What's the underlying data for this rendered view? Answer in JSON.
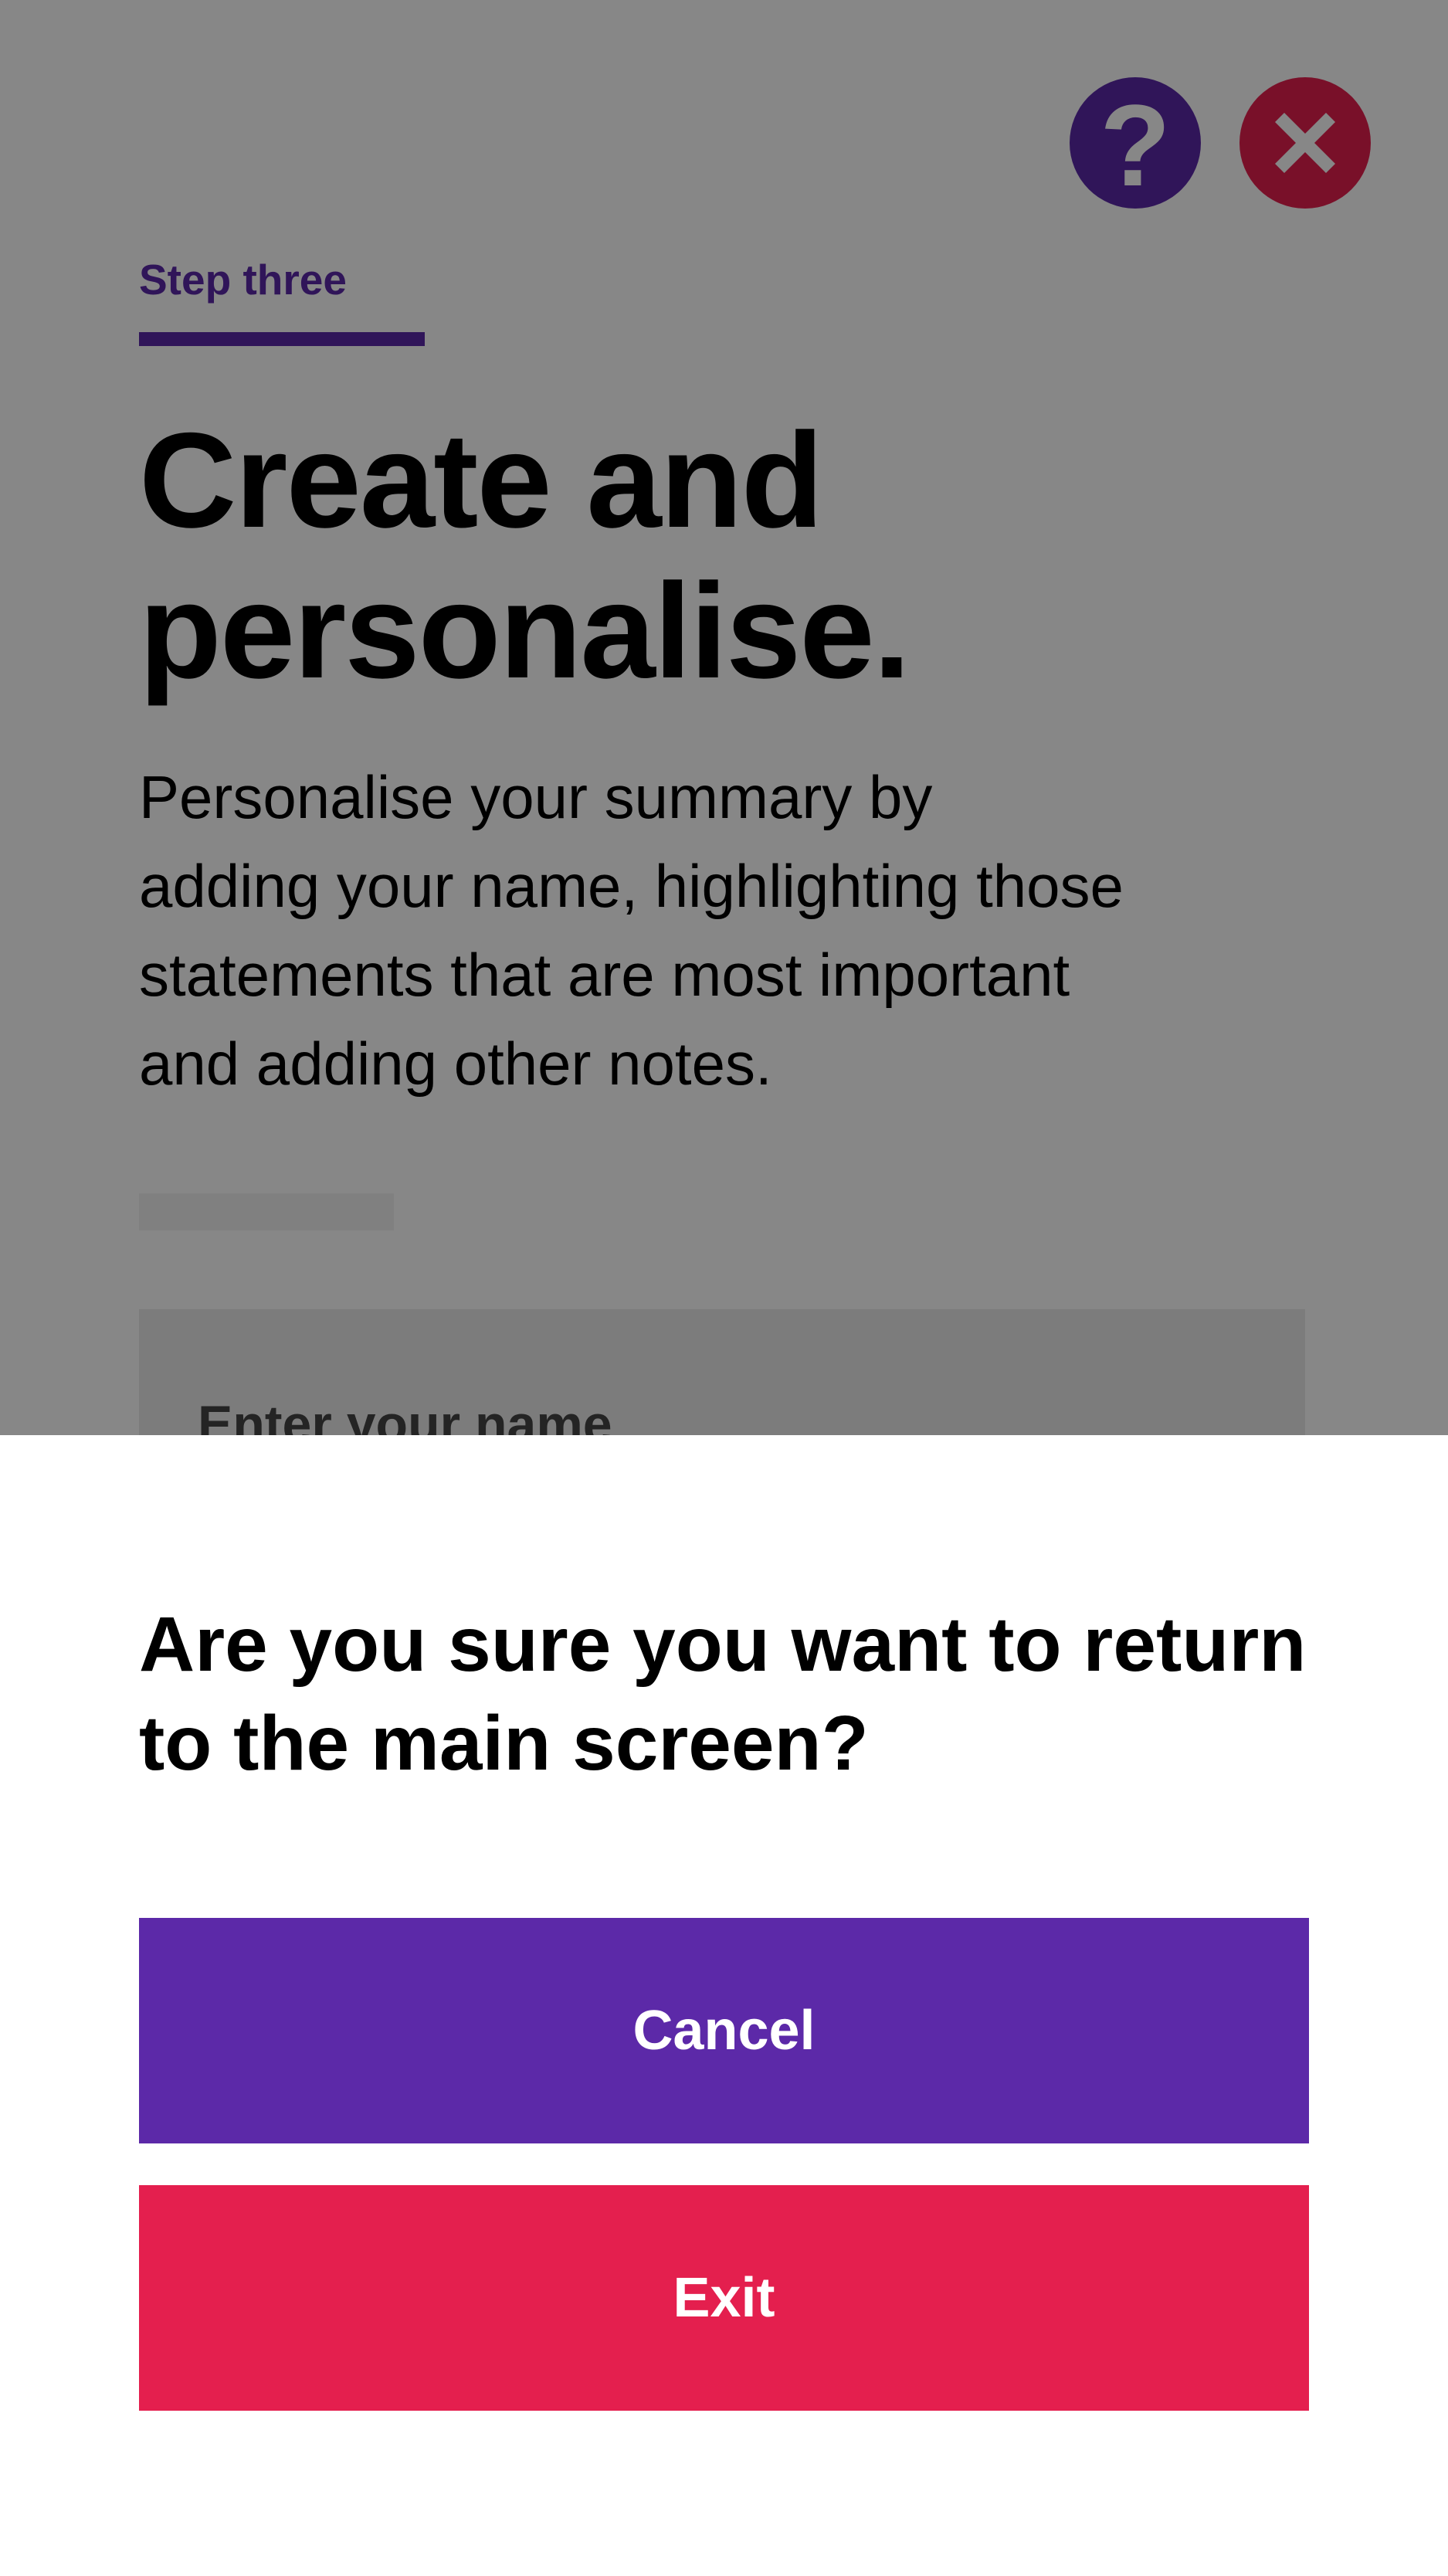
{
  "colors": {
    "brand_purple": "#5c29a8",
    "brand_red": "#e41f4e",
    "overlay": "rgba(0,0,0,0.47)"
  },
  "header": {
    "help_icon": "question-mark-icon",
    "help_glyph": "?",
    "close_icon": "close-x-icon"
  },
  "step": {
    "label": "Step three"
  },
  "main": {
    "title_line1": "Create and",
    "title_line2": "personalise.",
    "intro": "Personalise your summary by adding your name, highlighting those statements that are most important and adding other notes.",
    "name_field_label": "Enter your name"
  },
  "dialog": {
    "question": "Are you sure you want to return to the main screen?",
    "cancel_label": "Cancel",
    "exit_label": "Exit"
  }
}
